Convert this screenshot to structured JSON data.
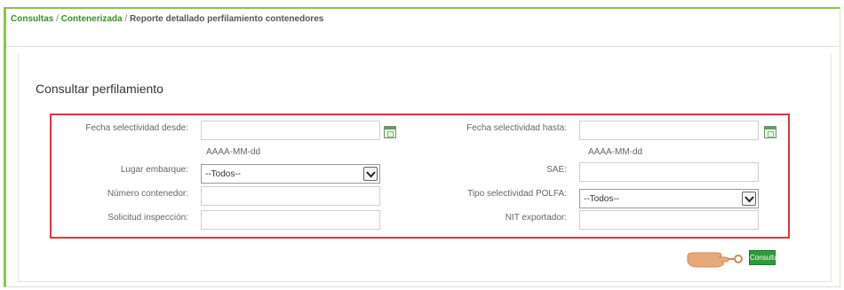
{
  "breadcrumb": {
    "item1": "Consultas",
    "separator": " / ",
    "item2": "Contenerizada",
    "current": "Reporte detallado perfilamiento contenedores"
  },
  "section_title": "Consultar perfilamiento",
  "form": {
    "fecha_desde": {
      "label": "Fecha selectividad desde:",
      "value": "",
      "hint": "AAAA-MM-dd"
    },
    "fecha_hasta": {
      "label": "Fecha selectividad hasta:",
      "value": "",
      "hint": "AAAA-MM-dd"
    },
    "lugar_embarque": {
      "label": "Lugar embarque:",
      "selected": "--Todos--"
    },
    "sae": {
      "label": "SAE:",
      "value": ""
    },
    "numero_contenedor": {
      "label": "Número contenedor:",
      "value": ""
    },
    "tipo_selectividad": {
      "label": "Tipo selectividad POLFA:",
      "selected": "--Todos--"
    },
    "solicitud_inspeccion": {
      "label": "Solicitud inspección:",
      "value": ""
    },
    "nit_exportador": {
      "label": "NIT exportador:",
      "value": ""
    }
  },
  "consultar_button": "Consultar",
  "colors": {
    "accent_green": "#8bc34a",
    "button_green": "#2e9a3a",
    "highlight_red": "#d9363e",
    "breadcrumb_link": "#3e8e2a"
  },
  "icons": [
    "calendar-icon",
    "chevron-down-icon",
    "pointing-hand-icon"
  ]
}
